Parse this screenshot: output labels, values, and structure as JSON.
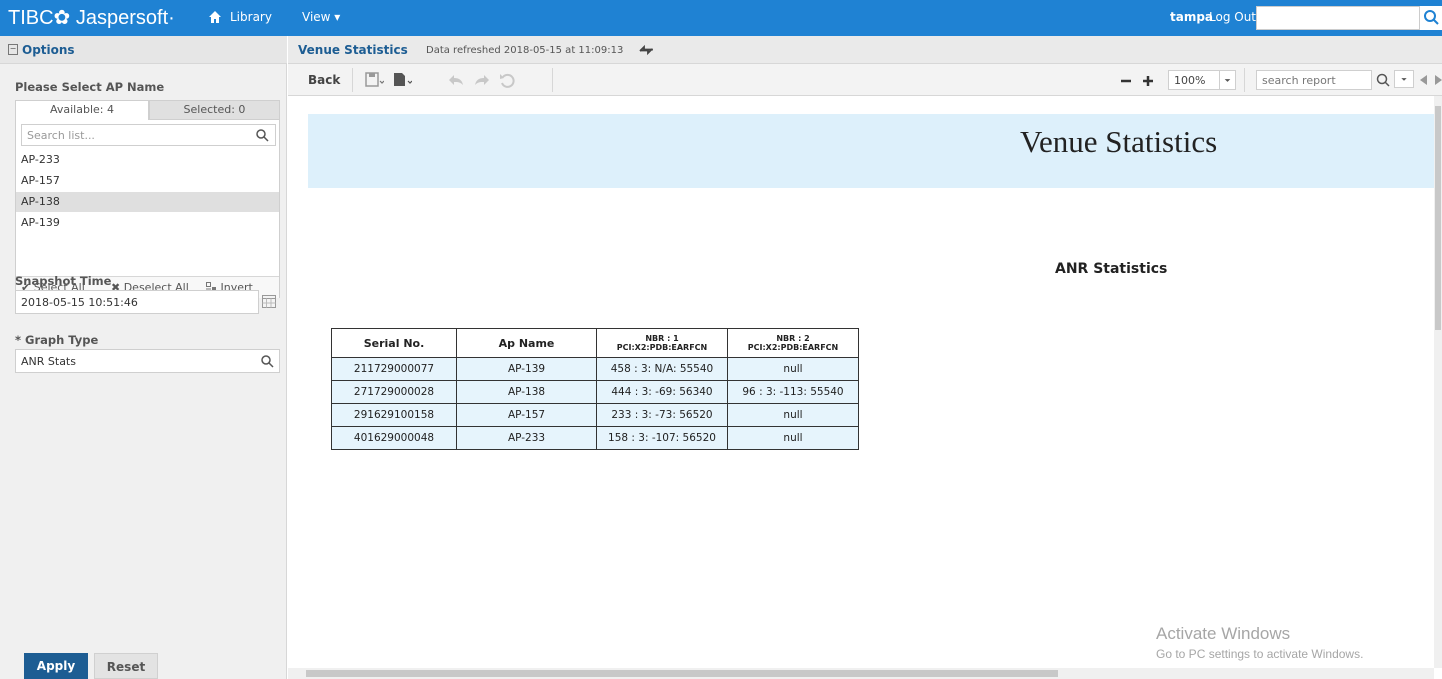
{
  "topbar": {
    "brand": "TIBC✿ Jaspersoft·",
    "nav_library": "Library",
    "nav_view": "View ▾",
    "user": "tampa",
    "logout": "Log Out",
    "search_value": ""
  },
  "options": {
    "title": "Options",
    "ap_label": "Please Select AP Name",
    "tab_available": "Available: 4",
    "tab_selected": "Selected: 0",
    "list_search_placeholder": "Search list...",
    "items": [
      "AP-233",
      "AP-157",
      "AP-138",
      "AP-139"
    ],
    "highlighted_item": "AP-138",
    "select_all": "✔ Select All",
    "deselect_all": "✖ Deselect All",
    "invert": "Invert",
    "snapshot_label": "Snapshot Time",
    "snapshot_value": "2018-05-15 10:51:46",
    "graph_type_label": "* Graph Type",
    "graph_type_value": "ANR Stats",
    "apply": "Apply",
    "reset": "Reset"
  },
  "report": {
    "title": "Venue Statistics",
    "refreshed": "Data refreshed 2018-05-15 at 11:09:13",
    "back": "Back",
    "zoom": "100%",
    "search_placeholder": "search report",
    "banner_title": "Venue Statistics",
    "section_title": "ANR Statistics",
    "table": {
      "headers": [
        "Serial No.",
        "Ap Name",
        "NBR : 1",
        "PCI:X2:PDB:EARFCN",
        "NBR : 2",
        "PCI:X2:PDB:EARFCN"
      ],
      "rows": [
        [
          "211729000077",
          "AP-139",
          "458 : 3: N/A: 55540",
          "null"
        ],
        [
          "271729000028",
          "AP-138",
          "444 : 3: -69: 56340",
          "96 : 3: -113: 55540"
        ],
        [
          "291629100158",
          "AP-157",
          "233 : 3: -73: 56520",
          "null"
        ],
        [
          "401629000048",
          "AP-233",
          "158 : 3: -107: 56520",
          "null"
        ]
      ]
    }
  },
  "watermark": {
    "line1": "Activate Windows",
    "line2": "Go to PC settings to activate Windows."
  },
  "colors": {
    "topbar": "#1f82d3",
    "accent": "#1d5d93",
    "banner": "#ddf0fb",
    "cell": "#e6f4fc"
  }
}
